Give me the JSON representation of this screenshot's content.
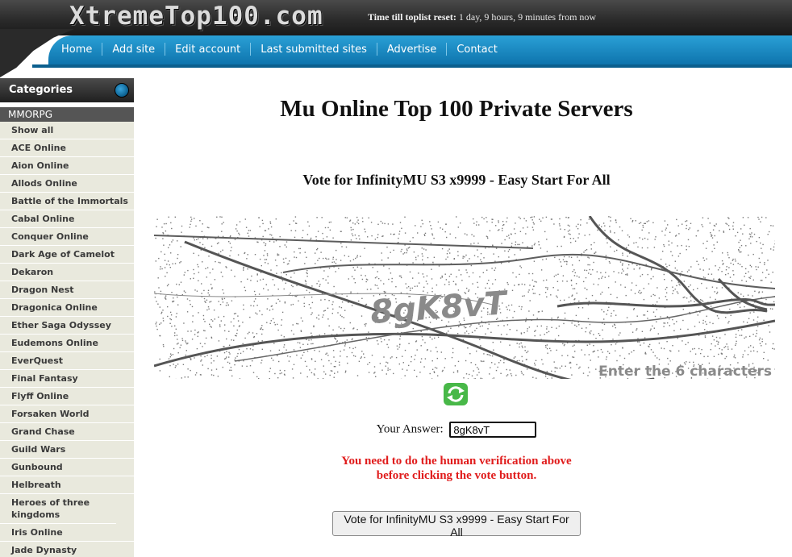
{
  "header": {
    "logo_text": "XtremeTop100.com",
    "reset_label": "Time till toplist reset:",
    "reset_value": "1 day, 9 hours, 9 minutes from now"
  },
  "nav": {
    "items": [
      "Home",
      "Add site",
      "Edit account",
      "Last submitted sites",
      "Advertise",
      "Contact"
    ]
  },
  "sidebar": {
    "heading": "Categories",
    "group": "MMORPG",
    "items": [
      "Show all",
      "ACE Online",
      "Aion Online",
      "Allods Online",
      "Battle of the Immortals",
      "Cabal Online",
      "Conquer Online",
      "Dark Age of Camelot",
      "Dekaron",
      "Dragon Nest",
      "Dragonica Online",
      "Ether Saga Odyssey",
      "Eudemons Online",
      "EverQuest",
      "Final Fantasy",
      "Flyff Online",
      "Forsaken World",
      "Grand Chase",
      "Guild Wars",
      "Gunbound",
      "Helbreath",
      "Heroes of three kingdoms",
      "Iris Online",
      "Jade Dynasty"
    ]
  },
  "main": {
    "title": "Mu Online Top 100 Private Servers",
    "vote_heading": "Vote for InfinityMU S3 x9999 - Easy Start For All",
    "captcha_text": "8gK8vT",
    "captcha_hint": "Enter the 6 characters",
    "answer_label": "Your Answer:",
    "answer_value": "8gK8vT",
    "error_line1": "You need to do the human verification above",
    "error_line2": "before clicking the vote button.",
    "vote_button": "Vote for InfinityMU S3 x9999 - Easy Start For All"
  },
  "colors": {
    "nav_blue": "#1a8fc8",
    "error_red": "#e01b1b",
    "refresh_green": "#3aa43a"
  },
  "icons": [
    "refresh-icon",
    "category-orb-icon"
  ]
}
